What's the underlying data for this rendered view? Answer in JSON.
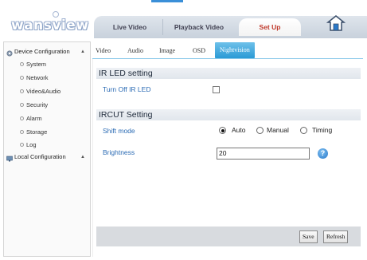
{
  "header": {
    "logo_text": "wansview",
    "tabs": [
      {
        "label": "Live Video"
      },
      {
        "label": "Playback Video"
      },
      {
        "label": "Set Up"
      }
    ],
    "home_icon": "home-icon"
  },
  "sidebar": {
    "device_configuration": {
      "label": "Device Configuration",
      "items": [
        {
          "label": "System"
        },
        {
          "label": "Network"
        },
        {
          "label": "Video&Audio"
        },
        {
          "label": "Security"
        },
        {
          "label": "Alarm"
        },
        {
          "label": "Storage"
        },
        {
          "label": "Log"
        }
      ]
    },
    "local_configuration": {
      "label": "Local Configuration"
    }
  },
  "main": {
    "subtabs": [
      {
        "label": "Video"
      },
      {
        "label": "Audio"
      },
      {
        "label": "Image"
      },
      {
        "label": "OSD"
      },
      {
        "label": "Nightvision"
      }
    ],
    "active_subtab": "Nightvision",
    "ir_led": {
      "title": "IR LED setting",
      "turn_off_label": "Turn Off IR LED",
      "turn_off_checked": false
    },
    "ircut": {
      "title": "IRCUT Setting",
      "shift_mode_label": "Shift mode",
      "options": [
        {
          "label": "Auto",
          "checked": true
        },
        {
          "label": "Manual",
          "checked": false
        },
        {
          "label": "Timing",
          "checked": false
        }
      ],
      "brightness_label": "Brightness",
      "brightness_value": "20"
    },
    "buttons": {
      "save": "Save",
      "refresh": "Refresh"
    }
  },
  "colors": {
    "accent_blue": "#2a9ad6",
    "label_blue": "#2b6bb4",
    "setup_tab_red": "#c0392b"
  }
}
